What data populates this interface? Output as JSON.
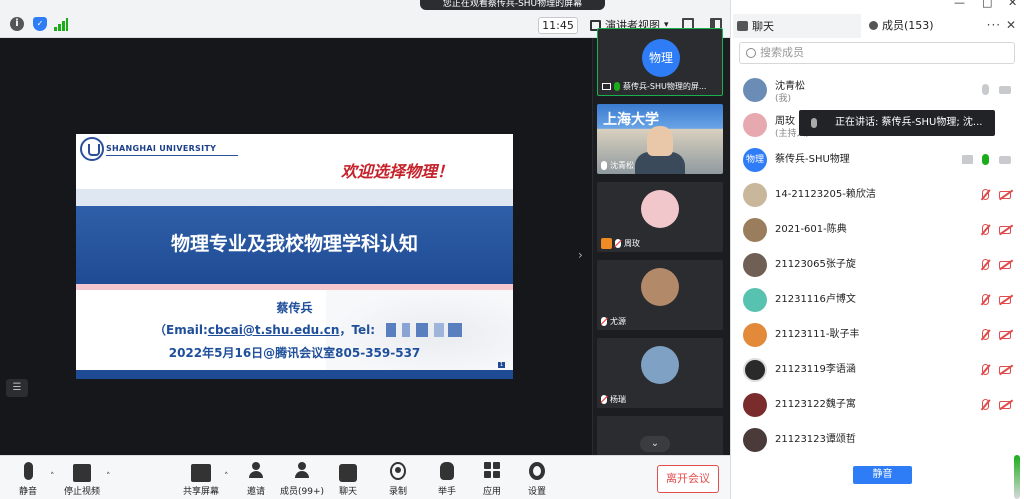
{
  "topbar": {
    "share_banner": "您正在观看蔡传兵-SHU物理的屏幕",
    "time": "11:45",
    "view_mode": "演讲者视图"
  },
  "slide": {
    "university": "SHANGHAI UNIVERSITY",
    "welcome": "欢迎选择物理！",
    "title": "物理专业及我校物理学科认知",
    "author": "蔡传兵",
    "email_prefix": "（Email:",
    "email": "cbcai@t.shu.edu.cn",
    "email_suffix": "，Tel:",
    "date_line": "2022年5月16日@腾讯会议室805-359-537",
    "page": "1"
  },
  "video_strip": [
    {
      "avatar_text": "物理",
      "label": "蔡传兵-SHU物理的屏..."
    },
    {
      "camera_sign": "上海大学",
      "label": "沈青松"
    },
    {
      "label": "周玫"
    },
    {
      "label": "尤源"
    },
    {
      "label": "杨瑞"
    }
  ],
  "toolbar": {
    "mute": "静音",
    "stop_video": "停止视频",
    "share_screen": "共享屏幕",
    "invite": "邀请",
    "members": "成员(99+)",
    "chat": "聊天",
    "record": "录制",
    "raise_hand": "举手",
    "apps": "应用",
    "settings": "设置",
    "leave": "离开会议"
  },
  "right_panel": {
    "chat_tab": "聊天",
    "members_tab": "成员(153)",
    "tab_more": "···",
    "tab_close": "✕",
    "search_placeholder": "搜索成员",
    "speaking_tip": "正在讲话: 蔡传兵-SHU物理; 沈...",
    "mute_all": "静音",
    "members": [
      {
        "name": "沈青松",
        "role": "(我)",
        "avatar_color": "#6b8db5"
      },
      {
        "name": "周玫",
        "role": "(主持人)",
        "avatar_color": "#e7a9b0"
      },
      {
        "name": "蔡传兵-SHU物理",
        "avatar_text": "物理",
        "avatar_color": "#2f7df6"
      },
      {
        "name": "14-21123205-赖欣洁",
        "avatar_color": "#c8b79a"
      },
      {
        "name": "2021-601-陈典",
        "avatar_color": "#9a7d5c"
      },
      {
        "name": "21123065张子旋",
        "avatar_color": "#6f5f55"
      },
      {
        "name": "21231116卢博文",
        "avatar_color": "#58c2b0"
      },
      {
        "name": "21123111-耿子丰",
        "avatar_color": "#e2893a"
      },
      {
        "name": "21123119李语涵",
        "avatar_color": "#2a2a2a"
      },
      {
        "name": "21123122魏子寓",
        "avatar_color": "#7a2b2b"
      },
      {
        "name": "21123123谭颂哲",
        "avatar_color": "#4a3a3a"
      }
    ]
  }
}
